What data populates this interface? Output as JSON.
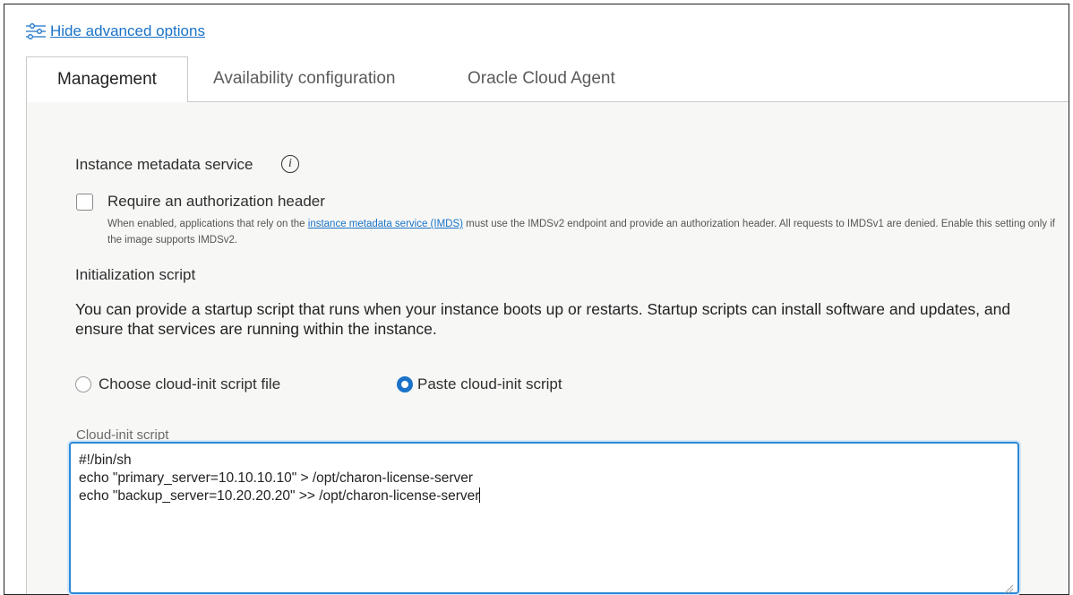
{
  "advanced_link": {
    "label": "Hide advanced options",
    "icon": "sliders-icon"
  },
  "tabs": [
    {
      "label": "Management",
      "active": true
    },
    {
      "label": "Availability configuration",
      "active": false
    },
    {
      "label": "Oracle Cloud Agent",
      "active": false
    }
  ],
  "imds": {
    "heading": "Instance metadata service",
    "info_icon": "i",
    "checkbox_label": "Require an authorization header",
    "checkbox_checked": false,
    "help_before": "When enabled, applications that rely on the ",
    "help_link": "instance metadata service (IMDS)",
    "help_after": " must use the IMDSv2 endpoint and provide an authorization header. All requests to IMDSv1 are denied. Enable this setting only if the image supports IMDSv2."
  },
  "init": {
    "heading": "Initialization script",
    "description": "You can provide a startup script that runs when your instance boots up or restarts. Startup scripts can install software and updates, and ensure that services are running within the instance.",
    "option_file": "Choose cloud-init script file",
    "option_paste": "Paste cloud-init script",
    "selected": "paste",
    "field_label": "Cloud-init script",
    "script": "#!/bin/sh\necho \"primary_server=10.10.10.10\" > /opt/charon-license-server\necho \"backup_server=10.20.20.20\" >> /opt/charon-license-server"
  },
  "colors": {
    "accent": "#1a73c8",
    "panel_bg": "#f7f7f6"
  }
}
